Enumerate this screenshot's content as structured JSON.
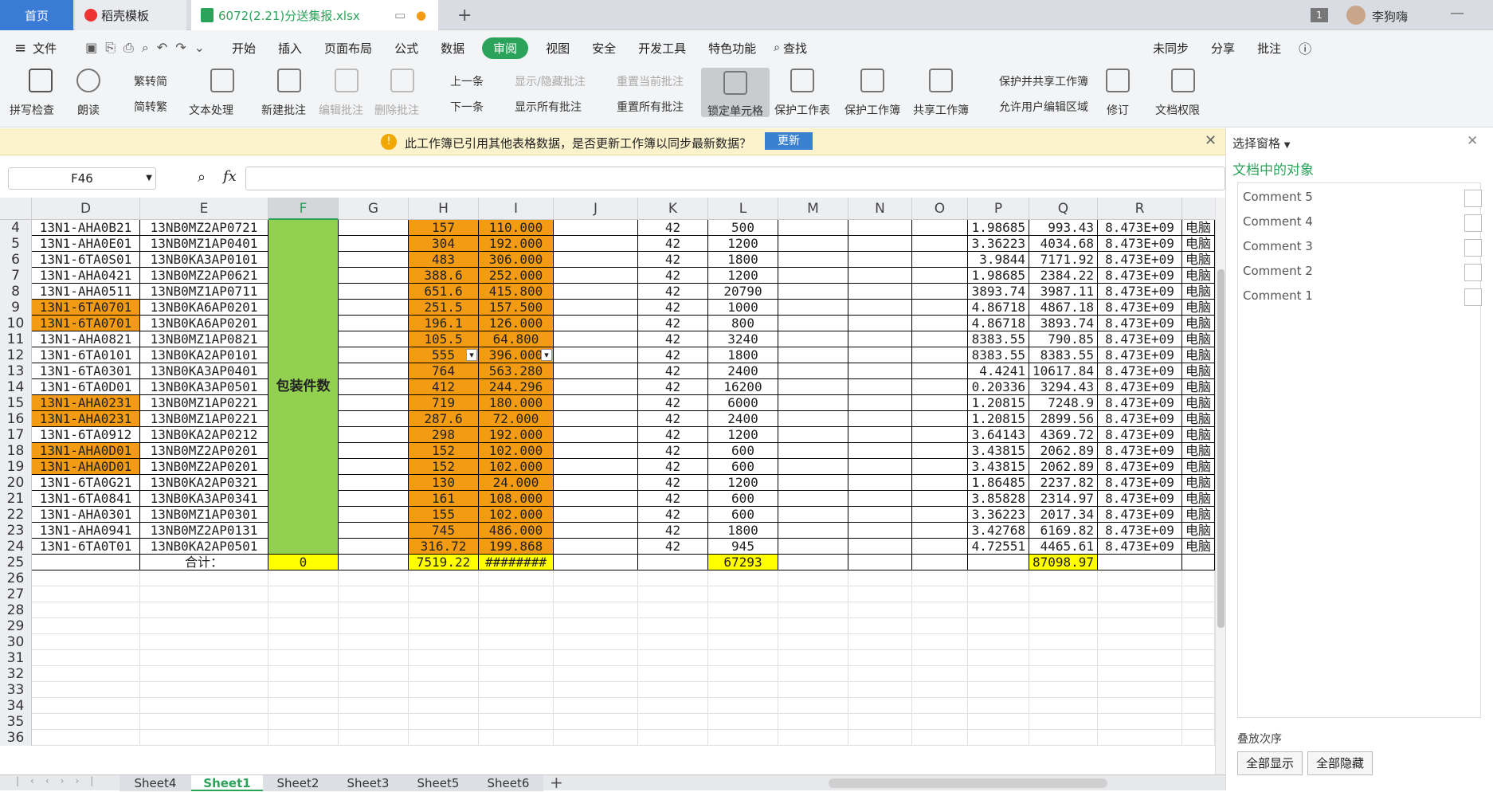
{
  "tabs": [
    {
      "label": "首页"
    },
    {
      "label": "稻壳模板"
    },
    {
      "label": "6072(2.21)分送集报.xlsx"
    }
  ],
  "title_bar": {
    "window_count": "1",
    "user_name": "李狗嗨"
  },
  "menu": {
    "file": "文件",
    "items": [
      "开始",
      "插入",
      "页面布局",
      "公式",
      "数据",
      "审阅",
      "视图",
      "安全",
      "开发工具",
      "特色功能"
    ],
    "active": "审阅",
    "search": "查找",
    "right": [
      "未同步",
      "分享",
      "批注"
    ]
  },
  "ribbon": {
    "spell_check": "拼写检查",
    "read_aloud": "朗读",
    "trad_to_simp": "繁转简",
    "simp_to_trad": "简转繁",
    "text_proc": "文本处理",
    "new_comment": "新建批注",
    "edit_comment": "编辑批注",
    "delete_comment": "删除批注",
    "prev": "上一条",
    "next": "下一条",
    "show_hide_comment": "显示/隐藏批注",
    "show_all_comments": "显示所有批注",
    "reset_current": "重置当前批注",
    "reset_all": "重置所有批注",
    "lock_cell": "锁定单元格",
    "protect_sheet": "保护工作表",
    "protect_book": "保护工作簿",
    "share_book": "共享工作簿",
    "protect_share": "保护并共享工作簿",
    "allow_edit": "允许用户编辑区域",
    "revise": "修订",
    "doc_rights": "文档权限"
  },
  "notice": {
    "text": "此工作簿已引用其他表格数据，是否更新工作簿以同步最新数据？",
    "button": "更新"
  },
  "formula_bar": {
    "cell_ref": "F46",
    "fx": "fx",
    "value": ""
  },
  "columns": [
    "D",
    "E",
    "F",
    "G",
    "H",
    "I",
    "J",
    "K",
    "L",
    "M",
    "N",
    "O",
    "P",
    "Q",
    "R"
  ],
  "merged_label": "包装件数",
  "rows": [
    {
      "n": "4",
      "d": "13N1-AHA0B21",
      "e": "13NB0MZ2AP0721",
      "h": "157",
      "i": "110.000",
      "k": "42",
      "l": "500",
      "p": "1.98685",
      "q": "993.43",
      "r": "8.473E+09",
      "s": "电脑",
      "do": false
    },
    {
      "n": "5",
      "d": "13N1-AHA0E01",
      "e": "13NB0MZ1AP0401",
      "h": "304",
      "i": "192.000",
      "k": "42",
      "l": "1200",
      "p": "3.36223",
      "q": "4034.68",
      "r": "8.473E+09",
      "s": "电脑",
      "do": false
    },
    {
      "n": "6",
      "d": "13N1-6TA0S01",
      "e": "13NB0KA3AP0101",
      "h": "483",
      "i": "306.000",
      "k": "42",
      "l": "1800",
      "p": "3.9844",
      "q": "7171.92",
      "r": "8.473E+09",
      "s": "电脑",
      "do": false
    },
    {
      "n": "7",
      "d": "13N1-AHA0421",
      "e": "13NB0MZ2AP0621",
      "h": "388.6",
      "i": "252.000",
      "k": "42",
      "l": "1200",
      "p": "1.98685",
      "q": "2384.22",
      "r": "8.473E+09",
      "s": "电脑",
      "do": false
    },
    {
      "n": "8",
      "d": "13N1-AHA0511",
      "e": "13NB0MZ1AP0711",
      "h": "651.6",
      "i": "415.800",
      "k": "42",
      "l": "20790",
      "p": "3893.74",
      "q": "3987.11",
      "r": "8.473E+09",
      "s": "电脑",
      "do": false
    },
    {
      "n": "9",
      "d": "13N1-6TA0701",
      "e": "13NB0KA6AP0201",
      "h": "251.5",
      "i": "157.500",
      "k": "42",
      "l": "1000",
      "p": "4.86718",
      "q": "4867.18",
      "r": "8.473E+09",
      "s": "电脑",
      "do": true
    },
    {
      "n": "10",
      "d": "13N1-6TA0701",
      "e": "13NB0KA6AP0201",
      "h": "196.1",
      "i": "126.000",
      "k": "42",
      "l": "800",
      "p": "4.86718",
      "q": "3893.74",
      "r": "8.473E+09",
      "s": "电脑",
      "do": true
    },
    {
      "n": "11",
      "d": "13N1-AHA0821",
      "e": "13NB0MZ1AP0821",
      "h": "105.5",
      "i": "64.800",
      "k": "42",
      "l": "3240",
      "p": "8383.55",
      "q": "790.85",
      "r": "8.473E+09",
      "s": "电脑",
      "do": false
    },
    {
      "n": "12",
      "d": "13N1-6TA0101",
      "e": "13NB0KA2AP0101",
      "h": "555",
      "i": "396.000",
      "k": "42",
      "l": "1800",
      "p": "8383.55",
      "q": "8383.55",
      "r": "8.473E+09",
      "s": "电脑",
      "do": false
    },
    {
      "n": "13",
      "d": "13N1-6TA0301",
      "e": "13NB0KA3AP0401",
      "h": "764",
      "i": "563.280",
      "k": "42",
      "l": "2400",
      "p": "4.4241",
      "q": "10617.84",
      "r": "8.473E+09",
      "s": "电脑",
      "do": false
    },
    {
      "n": "14",
      "d": "13N1-6TA0D01",
      "e": "13NB0KA3AP0501",
      "h": "412",
      "i": "244.296",
      "k": "42",
      "l": "16200",
      "p": "0.20336",
      "q": "3294.43",
      "r": "8.473E+09",
      "s": "电脑",
      "do": false
    },
    {
      "n": "15",
      "d": "13N1-AHA0231",
      "e": "13NB0MZ1AP0221",
      "h": "719",
      "i": "180.000",
      "k": "42",
      "l": "6000",
      "p": "1.20815",
      "q": "7248.9",
      "r": "8.473E+09",
      "s": "电脑",
      "do": true
    },
    {
      "n": "16",
      "d": "13N1-AHA0231",
      "e": "13NB0MZ1AP0221",
      "h": "287.6",
      "i": "72.000",
      "k": "42",
      "l": "2400",
      "p": "1.20815",
      "q": "2899.56",
      "r": "8.473E+09",
      "s": "电脑",
      "do": true
    },
    {
      "n": "17",
      "d": "13N1-6TA0912",
      "e": "13NB0KA2AP0212",
      "h": "298",
      "i": "192.000",
      "k": "42",
      "l": "1200",
      "p": "3.64143",
      "q": "4369.72",
      "r": "8.473E+09",
      "s": "电脑",
      "do": false
    },
    {
      "n": "18",
      "d": "13N1-AHA0D01",
      "e": "13NB0MZ2AP0201",
      "h": "152",
      "i": "102.000",
      "k": "42",
      "l": "600",
      "p": "3.43815",
      "q": "2062.89",
      "r": "8.473E+09",
      "s": "电脑",
      "do": true
    },
    {
      "n": "19",
      "d": "13N1-AHA0D01",
      "e": "13NB0MZ2AP0201",
      "h": "152",
      "i": "102.000",
      "k": "42",
      "l": "600",
      "p": "3.43815",
      "q": "2062.89",
      "r": "8.473E+09",
      "s": "电脑",
      "do": true
    },
    {
      "n": "20",
      "d": "13N1-6TA0G21",
      "e": "13NB0KA2AP0321",
      "h": "130",
      "i": "24.000",
      "k": "42",
      "l": "1200",
      "p": "1.86485",
      "q": "2237.82",
      "r": "8.473E+09",
      "s": "电脑",
      "do": false
    },
    {
      "n": "21",
      "d": "13N1-6TA0841",
      "e": "13NB0KA3AP0341",
      "h": "161",
      "i": "108.000",
      "k": "42",
      "l": "600",
      "p": "3.85828",
      "q": "2314.97",
      "r": "8.473E+09",
      "s": "电脑",
      "do": false
    },
    {
      "n": "22",
      "d": "13N1-AHA0301",
      "e": "13NB0MZ1AP0301",
      "h": "155",
      "i": "102.000",
      "k": "42",
      "l": "600",
      "p": "3.36223",
      "q": "2017.34",
      "r": "8.473E+09",
      "s": "电脑",
      "do": false
    },
    {
      "n": "23",
      "d": "13N1-AHA0941",
      "e": "13NB0MZ2AP0131",
      "h": "745",
      "i": "486.000",
      "k": "42",
      "l": "1800",
      "p": "3.42768",
      "q": "6169.82",
      "r": "8.473E+09",
      "s": "电脑",
      "do": false
    },
    {
      "n": "24",
      "d": "13N1-6TA0T01",
      "e": "13NB0KA2AP0501",
      "h": "316.72",
      "i": "199.868",
      "k": "42",
      "l": "945",
      "p": "4.72551",
      "q": "4465.61",
      "r": "8.473E+09",
      "s": "电脑",
      "do": false
    }
  ],
  "total_row": {
    "n": "25",
    "label": "合计：",
    "f": "0",
    "h": "7519.22",
    "i": "########",
    "l": "67293",
    "q": "87098.97"
  },
  "empty_rows": [
    "26",
    "27",
    "28",
    "29",
    "30",
    "31",
    "32",
    "33",
    "34",
    "35",
    "36"
  ],
  "sheets": [
    "Sheet4",
    "Sheet1",
    "Sheet2",
    "Sheet3",
    "Sheet5",
    "Sheet6"
  ],
  "active_sheet": "Sheet1",
  "pane": {
    "title": "选择窗格",
    "subtitle": "文档中的对象",
    "objects": [
      "Comment 5",
      "Comment 4",
      "Comment 3",
      "Comment 2",
      "Comment 1"
    ],
    "order_label": "叠放次序",
    "show_all": "全部显示",
    "hide_all": "全部隐藏"
  },
  "colors": {
    "accent": "#2ca35a",
    "orange": "#f39b12",
    "green": "#92d050",
    "yellow": "#ffff00"
  }
}
